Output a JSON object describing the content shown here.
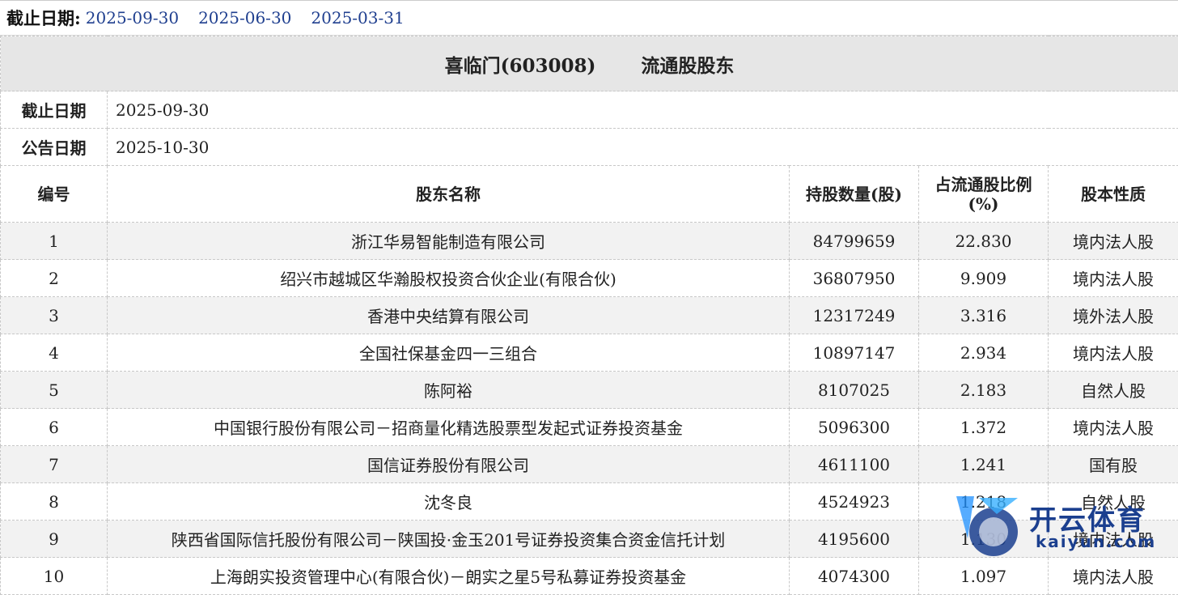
{
  "filter": {
    "label": "截止日期:",
    "dates": [
      "2025-09-30",
      "2025-06-30",
      "2025-03-31"
    ]
  },
  "title": {
    "company": "喜临门(603008)",
    "section": "流通股股东"
  },
  "info": {
    "end_date_label": "截止日期",
    "end_date": "2025-09-30",
    "announce_label": "公告日期",
    "announce_date": "2025-10-30"
  },
  "table": {
    "headers": [
      "编号",
      "股东名称",
      "持股数量(股)",
      "占流通股比例(%)",
      "股本性质"
    ],
    "rows": [
      {
        "no": "1",
        "name": "浙江华易智能制造有限公司",
        "shares": "84799659",
        "ratio": "22.830",
        "type": "境内法人股"
      },
      {
        "no": "2",
        "name": "绍兴市越城区华瀚股权投资合伙企业(有限合伙)",
        "shares": "36807950",
        "ratio": "9.909",
        "type": "境内法人股"
      },
      {
        "no": "3",
        "name": "香港中央结算有限公司",
        "shares": "12317249",
        "ratio": "3.316",
        "type": "境外法人股"
      },
      {
        "no": "4",
        "name": "全国社保基金四一三组合",
        "shares": "10897147",
        "ratio": "2.934",
        "type": "境内法人股"
      },
      {
        "no": "5",
        "name": "陈阿裕",
        "shares": "8107025",
        "ratio": "2.183",
        "type": "自然人股"
      },
      {
        "no": "6",
        "name": "中国银行股份有限公司－招商量化精选股票型发起式证券投资基金",
        "shares": "5096300",
        "ratio": "1.372",
        "type": "境内法人股"
      },
      {
        "no": "7",
        "name": "国信证券股份有限公司",
        "shares": "4611100",
        "ratio": "1.241",
        "type": "国有股"
      },
      {
        "no": "8",
        "name": "沈冬良",
        "shares": "4524923",
        "ratio": "1.218",
        "type": "自然人股"
      },
      {
        "no": "9",
        "name": "陕西省国际信托股份有限公司－陕国投·金玉201号证券投资集合资金信托计划",
        "shares": "4195600",
        "ratio": "1.130",
        "type": "境内法人股"
      },
      {
        "no": "10",
        "name": "上海朗实投资管理中心(有限合伙)－朗实之星5号私募证券投资基金",
        "shares": "4074300",
        "ratio": "1.097",
        "type": "境内法人股"
      }
    ]
  },
  "watermark": {
    "text": "开云体育",
    "sub": "kaiyun.com"
  },
  "colors": {
    "link": "#1f3f8f",
    "header_bg": "#e6e6e6",
    "row_alt": "#f2f2f2"
  }
}
